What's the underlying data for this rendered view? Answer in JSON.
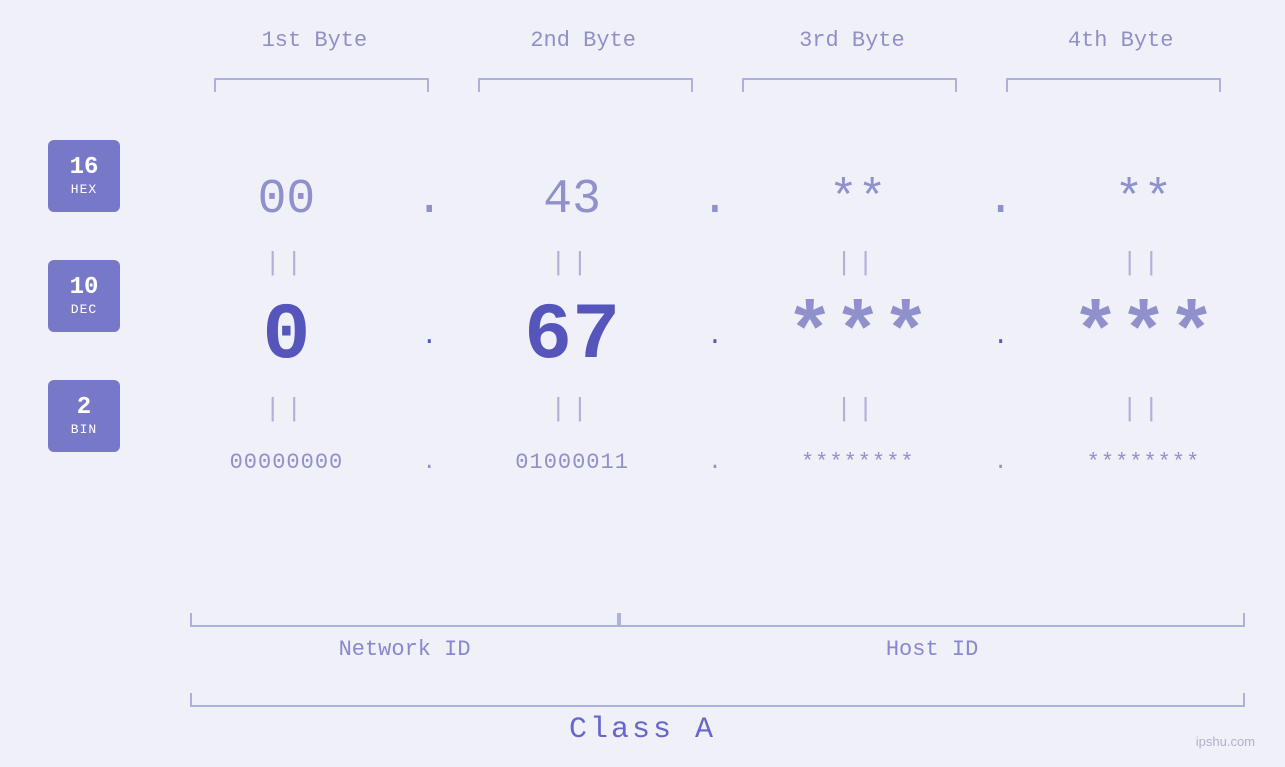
{
  "badges": [
    {
      "id": "hex-badge",
      "num": "16",
      "label": "HEX"
    },
    {
      "id": "dec-badge",
      "num": "10",
      "label": "DEC"
    },
    {
      "id": "bin-badge",
      "num": "2",
      "label": "BIN"
    }
  ],
  "col_headers": [
    {
      "id": "col1",
      "label": "1st Byte"
    },
    {
      "id": "col2",
      "label": "2nd Byte"
    },
    {
      "id": "col3",
      "label": "3rd Byte"
    },
    {
      "id": "col4",
      "label": "4th Byte"
    }
  ],
  "hex_row": {
    "col1": "00",
    "col2": "43",
    "col3": "**",
    "col4": "**",
    "dots": [
      ".",
      ".",
      "."
    ]
  },
  "dec_row": {
    "col1": "0",
    "col2": "67",
    "col3": "***",
    "col4": "***",
    "dots": [
      ".",
      ".",
      "."
    ]
  },
  "bin_row": {
    "col1": "00000000",
    "col2": "01000011",
    "col3": "********",
    "col4": "********",
    "dots": [
      ".",
      ".",
      "."
    ]
  },
  "eq_signs": [
    "||",
    "||",
    "||",
    "||"
  ],
  "network_id_label": "Network ID",
  "host_id_label": "Host ID",
  "class_label": "Class A",
  "watermark": "ipshu.com"
}
